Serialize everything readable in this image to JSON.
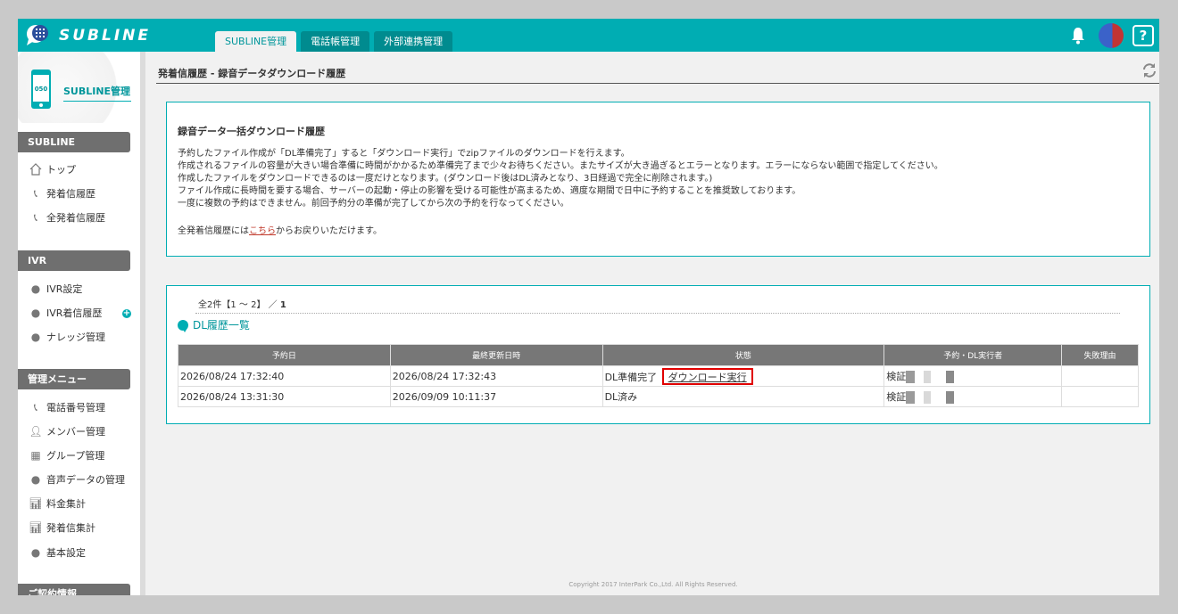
{
  "app": {
    "brand": "SUBLINE"
  },
  "header": {
    "tabs": [
      {
        "label": "SUBLINE管理",
        "active": true
      },
      {
        "label": "電話帳管理",
        "active": false
      },
      {
        "label": "外部連携管理",
        "active": false
      }
    ],
    "help_label": "?"
  },
  "sidebar": {
    "phone_badge": "050",
    "title": "SUBLINE管理",
    "sections": [
      {
        "label": "SUBLINE",
        "items": [
          "トップ",
          "発着信履歴",
          "全発着信履歴"
        ]
      },
      {
        "label": "IVR",
        "items": [
          "IVR設定",
          "IVR着信履歴",
          "ナレッジ管理"
        ]
      },
      {
        "label": "管理メニュー",
        "items": [
          "電話番号管理",
          "メンバー管理",
          "グループ管理",
          "音声データの管理",
          "料金集計",
          "発着信集計",
          "基本設定"
        ]
      },
      {
        "label": "ご契約情報"
      }
    ],
    "plus_label": "+"
  },
  "main": {
    "page_title": "発着信履歴 - 録音データダウンロード履歴",
    "info": {
      "title": "録音データ一括ダウンロード履歴",
      "lines": [
        "予約したファイル作成が「DL準備完了」すると「ダウンロード実行」でzipファイルのダウンロードを行えます。",
        "作成されるファイルの容量が大きい場合準備に時間がかかるため準備完了まで少々お待ちください。またサイズが大き過ぎるとエラーとなります。エラーにならない範囲で指定してください。",
        "作成したファイルをダウンロードできるのは一度だけとなります。(ダウンロード後はDL済みとなり、3日経過で完全に削除されます。)",
        "ファイル作成に長時間を要する場合、サーバーの起動・停止の影響を受ける可能性が高まるため、適度な期間で日中に予約することを推奨致しております。",
        "一度に複数の予約はできません。前回予約分の準備が完了してから次の予約を行なってください。"
      ],
      "back_prefix": "全発着信履歴には",
      "back_link": "こちら",
      "back_suffix": "からお戻りいただけます。"
    },
    "list": {
      "count_prefix": "全2件【1 ～ 2】 ／ ",
      "count_page": "1",
      "title": "DL履歴一覧",
      "columns": [
        "予約日",
        "最終更新日時",
        "状態",
        "予約・DL実行者",
        "失敗理由"
      ],
      "rows": [
        {
          "reserved": "2026/08/24 17:32:40",
          "updated": "2026/08/24 17:32:43",
          "status": "DL準備完了",
          "action": "ダウンロード実行",
          "user": "検証",
          "reason": ""
        },
        {
          "reserved": "2026/08/24 13:31:30",
          "updated": "2026/09/09 10:11:37",
          "status": "DL済み",
          "action": "",
          "user": "検証",
          "reason": ""
        }
      ]
    },
    "footer": "Copyright 2017 InterPark Co.,Ltd. All Rights Reserved."
  },
  "colors": {
    "accent": "#00adb3",
    "highlight": "#e00000"
  }
}
